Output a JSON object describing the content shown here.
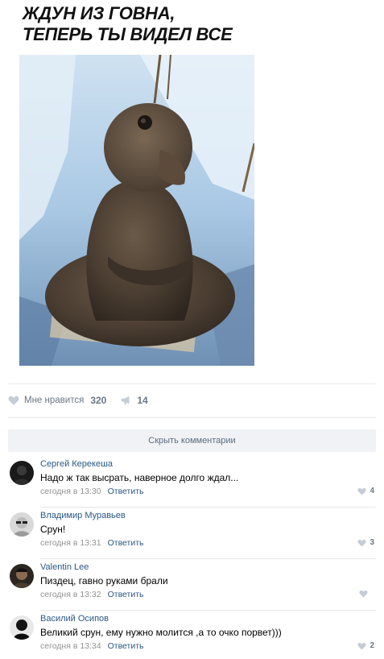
{
  "post": {
    "image_caption_line1": "ЖДУН ИЗ ГОВНА,",
    "image_caption_line2": "ТЕПЕРЬ ТЫ ВИДЕЛ ВСЕ",
    "like_label": "Мне нравится",
    "like_count": "320",
    "share_count": "14"
  },
  "hide_comments_label": "Скрыть комментарии",
  "comments": [
    {
      "author": "Сергей Керекеша",
      "text": "Надо ж так высрать, наверное долго ждал...",
      "time": "сегодня в 13:30",
      "reply": "Ответить",
      "likes": "4"
    },
    {
      "author": "Владимир Муравьев",
      "text": "Срун!",
      "time": "сегодня в 13:31",
      "reply": "Ответить",
      "likes": "3"
    },
    {
      "author": "Valentin Lee",
      "text": "Пиздец, гавно руками брали",
      "time": "сегодня в 13:32",
      "reply": "Ответить",
      "likes": ""
    },
    {
      "author": "Василий Осипов",
      "text": "Великий срун, ему нужно молится ,а то очко порвет)))",
      "time": "сегодня в 13:34",
      "reply": "Ответить",
      "likes": "2"
    }
  ],
  "colors": {
    "link": "#2a5885",
    "meta": "#939393",
    "counter": "#6b7785",
    "divider": "#e7e8ec",
    "button_bg": "#f0f2f5"
  }
}
